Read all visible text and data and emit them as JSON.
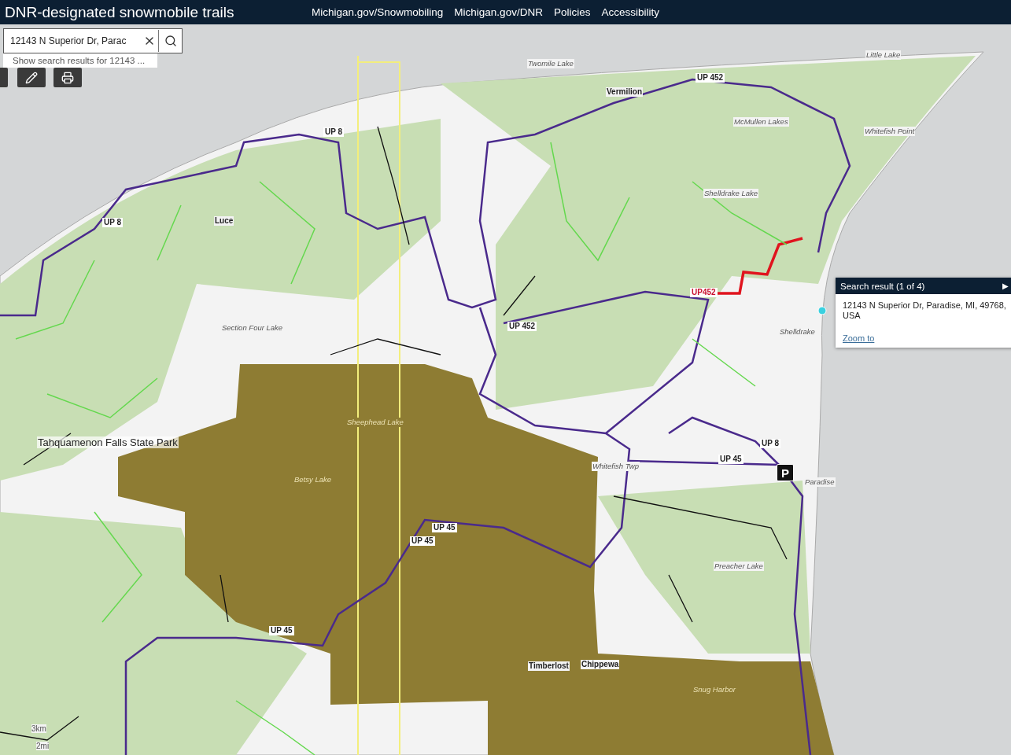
{
  "header": {
    "title": "DNR-designated snowmobile trails",
    "links": [
      "Michigan.gov/Snowmobiling",
      "Michigan.gov/DNR",
      "Policies",
      "Accessibility"
    ]
  },
  "search": {
    "value": "12143 N Superior Dr, Parac",
    "suggestion": "Show search results for 12143 ..."
  },
  "popup": {
    "title": "Search result (1 of 4)",
    "next": "▶",
    "address": "12143 N Superior Dr, Paradise, MI, 49768, USA",
    "action": "Zoom to"
  },
  "map_labels": [
    {
      "text": "Tahquamenon Falls State Park",
      "kind": "park"
    },
    {
      "text": "Luce",
      "kind": "place"
    },
    {
      "text": "Chippewa",
      "kind": "place"
    },
    {
      "text": "Timberlost",
      "kind": "place"
    },
    {
      "text": "Vermilion",
      "kind": "place"
    },
    {
      "text": "Whitefish Twp",
      "kind": "water"
    },
    {
      "text": "Shelldrake",
      "kind": "water"
    },
    {
      "text": "Paradise",
      "kind": "water"
    },
    {
      "text": "Section Four Lake",
      "kind": "water"
    },
    {
      "text": "Shelldrake Lake",
      "kind": "water"
    },
    {
      "text": "Twomile Lake",
      "kind": "water"
    },
    {
      "text": "Little Lake",
      "kind": "water"
    },
    {
      "text": "McMullen Lakes",
      "kind": "water"
    },
    {
      "text": "Whitefish Point",
      "kind": "water"
    },
    {
      "text": "Preacher Lake",
      "kind": "water"
    },
    {
      "text": "Snug Harbor",
      "kind": "park_water"
    },
    {
      "text": "Sheephead Lake",
      "kind": "park_water"
    },
    {
      "text": "Betsy Lake",
      "kind": "park_water"
    },
    {
      "text": "UP 452",
      "kind": "trail"
    },
    {
      "text": "UP 8",
      "kind": "trail"
    },
    {
      "text": "UP 8",
      "kind": "trail"
    },
    {
      "text": "UP 452",
      "kind": "trail"
    },
    {
      "text": "UP 45",
      "kind": "trail"
    },
    {
      "text": "UP 45",
      "kind": "trail"
    },
    {
      "text": "UP 45",
      "kind": "trail"
    },
    {
      "text": "UP 8",
      "kind": "trail"
    },
    {
      "text": "UP452",
      "kind": "trail_selected"
    },
    {
      "text": "UP 45",
      "kind": "trail"
    }
  ],
  "parking": "P",
  "scale": [
    "3km",
    "2mi"
  ]
}
